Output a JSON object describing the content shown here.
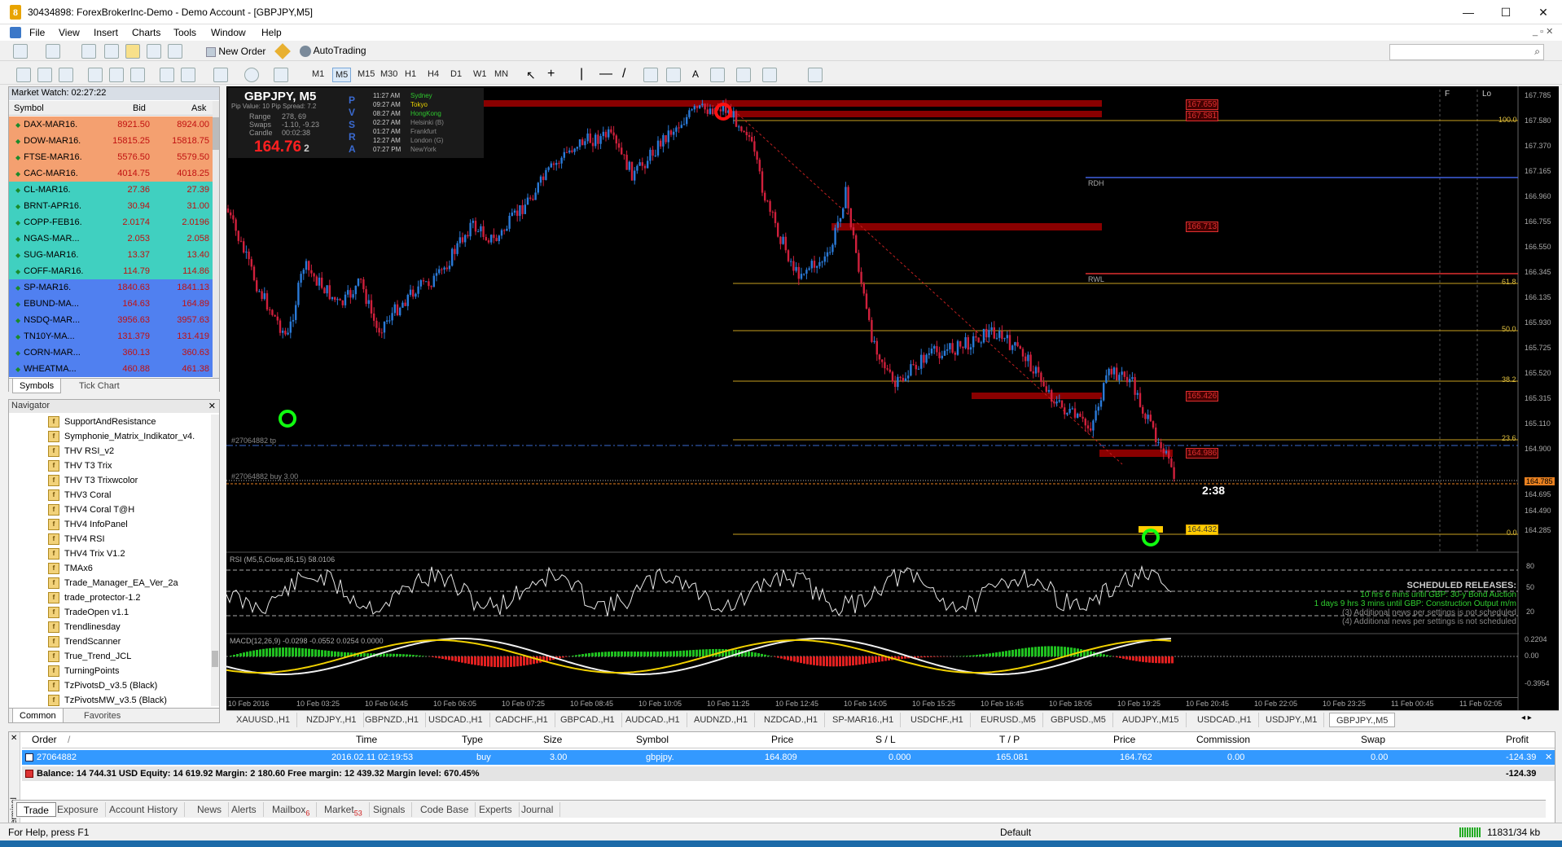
{
  "window": {
    "title": "30434898: ForexBrokerInc-Demo - Demo Account - [GBPJPY,M5]",
    "minimize": "—",
    "maximize": "☐",
    "close": "✕"
  },
  "menu": [
    "File",
    "View",
    "Insert",
    "Charts",
    "Tools",
    "Window",
    "Help"
  ],
  "toolbar": {
    "new_order": "New Order",
    "autotrading": "AutoTrading"
  },
  "timeframes": [
    "M1",
    "M5",
    "M15",
    "M30",
    "H1",
    "H4",
    "D1",
    "W1",
    "MN"
  ],
  "market_watch": {
    "title": "Market Watch: 02:27:22",
    "columns": [
      "Symbol",
      "Bid",
      "Ask"
    ],
    "rows": [
      {
        "symbol": "DAX-MAR16.",
        "bid": "8921.50",
        "ask": "8924.00",
        "bg": "#f4a070"
      },
      {
        "symbol": "DOW-MAR16.",
        "bid": "15815.25",
        "ask": "15818.75",
        "bg": "#f4a070"
      },
      {
        "symbol": "FTSE-MAR16.",
        "bid": "5576.50",
        "ask": "5579.50",
        "bg": "#f4a070"
      },
      {
        "symbol": "CAC-MAR16.",
        "bid": "4014.75",
        "ask": "4018.25",
        "bg": "#f4a070"
      },
      {
        "symbol": "CL-MAR16.",
        "bid": "27.36",
        "ask": "27.39",
        "bg": "#40d0c0"
      },
      {
        "symbol": "BRNT-APR16.",
        "bid": "30.94",
        "ask": "31.00",
        "bg": "#40d0c0"
      },
      {
        "symbol": "COPP-FEB16.",
        "bid": "2.0174",
        "ask": "2.0196",
        "bg": "#40d0c0"
      },
      {
        "symbol": "NGAS-MAR...",
        "bid": "2.053",
        "ask": "2.058",
        "bg": "#40d0c0"
      },
      {
        "symbol": "SUG-MAR16.",
        "bid": "13.37",
        "ask": "13.40",
        "bg": "#40d0c0"
      },
      {
        "symbol": "COFF-MAR16.",
        "bid": "114.79",
        "ask": "114.86",
        "bg": "#40d0c0"
      },
      {
        "symbol": "SP-MAR16.",
        "bid": "1840.63",
        "ask": "1841.13",
        "bg": "#5080f0"
      },
      {
        "symbol": "EBUND-MA...",
        "bid": "164.63",
        "ask": "164.89",
        "bg": "#5080f0"
      },
      {
        "symbol": "NSDQ-MAR...",
        "bid": "3956.63",
        "ask": "3957.63",
        "bg": "#5080f0"
      },
      {
        "symbol": "TN10Y-MA...",
        "bid": "131.379",
        "ask": "131.419",
        "bg": "#5080f0"
      },
      {
        "symbol": "CORN-MAR...",
        "bid": "360.13",
        "ask": "360.63",
        "bg": "#5080f0"
      },
      {
        "symbol": "WHEATMA...",
        "bid": "460.88",
        "ask": "461.38",
        "bg": "#5080f0"
      }
    ],
    "tabs": [
      "Symbols",
      "Tick Chart"
    ]
  },
  "navigator": {
    "title": "Navigator",
    "items": [
      "SupportAndResistance",
      "Symphonie_Matrix_Indikator_v4.",
      "THV RSI_v2",
      "THV T3 Trix",
      "THV T3 Trixwcolor",
      "THV3 Coral",
      "THV4 Coral  T@H",
      "THV4 InfoPanel",
      "THV4 RSI",
      "THV4 Trix V1.2",
      "TMAx6",
      "Trade_Manager_EA_Ver_2a",
      "trade_protector-1.2",
      "TradeOpen v1.1",
      "Trendlinesday",
      "TrendScanner",
      "True_Trend_JCL",
      "TurningPoints",
      "TzPivotsD_v3.5 (Black)",
      "TzPivotsMW_v3.5 (Black)"
    ],
    "tabs": [
      "Common",
      "Favorites"
    ]
  },
  "chart": {
    "symbol": "GBPJPY, M5",
    "pip_value": "Pip Value: 10  Pip Spread: 7.2",
    "info_labels": [
      "Range",
      "Swaps",
      "Candle"
    ],
    "info_values": [
      "278, 69",
      "-1.10, -9.23",
      "00:02:38"
    ],
    "price": "164.76",
    "price_small": "2",
    "pvsra": [
      "P",
      "V",
      "S",
      "R",
      "A"
    ],
    "sessions": [
      {
        "time": "11:27 AM",
        "city": "Sydney",
        "color": "#2ec82e"
      },
      {
        "time": "09:27 AM",
        "city": "Tokyo",
        "color": "#e8d000"
      },
      {
        "time": "08:27 AM",
        "city": "HongKong",
        "color": "#2ec82e"
      },
      {
        "time": "02:27 AM",
        "city": "Helsinki  (B)",
        "color": "#888888"
      },
      {
        "time": "01:27 AM",
        "city": "Frankfurt",
        "color": "#888888"
      },
      {
        "time": "12:27 AM",
        "city": "London  (G)",
        "color": "#888888"
      },
      {
        "time": "07:27 PM",
        "city": "NewYork",
        "color": "#888888"
      }
    ],
    "price_scale": [
      "167.785",
      "167.580",
      "167.370",
      "167.165",
      "166.960",
      "166.755",
      "166.550",
      "166.345",
      "166.135",
      "165.930",
      "165.725",
      "165.520",
      "165.315",
      "165.110",
      "164.900",
      "164.785",
      "164.695",
      "164.490",
      "164.285"
    ],
    "zone_labels": [
      "167.659",
      "167.581",
      "166.713",
      "165.426",
      "164.986",
      "164.432"
    ],
    "fib_levels": [
      "100.0",
      "61.8",
      "50.0",
      "38.2",
      "23.6",
      "0.0"
    ],
    "rdh": "RDH",
    "rwl": "RWL",
    "tp_label": "#27064882 tp",
    "buy_label": "#27064882 buy 3.00",
    "countdown": "2:38",
    "lo": "Lo",
    "f": "F",
    "rsi_label": "RSI (M5,5,Close,85,15) 58.0106",
    "rsi_scale": [
      "80",
      "50",
      "20"
    ],
    "macd_label": "MACD(12,26,9) -0.0298 -0.0552 0.0254 0.0000",
    "macd_scale": [
      "0.2204",
      "0.00",
      "-0.3954"
    ],
    "scheduled_title": "SCHEDULED RELEASES:",
    "scheduled": [
      "10 hrs 6 mins until GBP: 30-y Bond Auction",
      "1 days 9 hrs 3 mins until GBP: Construction Output m/m",
      "(3)  Additional news per settings is not scheduled",
      "(4)  Additional news per settings is not scheduled"
    ],
    "time_axis": [
      "10 Feb 2016",
      "10 Feb 03:25",
      "10 Feb 04:45",
      "10 Feb 06:05",
      "10 Feb 07:25",
      "10 Feb 08:45",
      "10 Feb 10:05",
      "10 Feb 11:25",
      "10 Feb 12:45",
      "10 Feb 14:05",
      "10 Feb 15:25",
      "10 Feb 16:45",
      "10 Feb 18:05",
      "10 Feb 19:25",
      "10 Feb 20:45",
      "10 Feb 22:05",
      "10 Feb 23:25",
      "11 Feb 00:45",
      "11 Feb 02:05"
    ]
  },
  "symbol_tabs": [
    "XAUUSD.,H1",
    "NZDJPY.,H1",
    "GBPNZD.,H1",
    "USDCAD.,H1",
    "CADCHF.,H1",
    "GBPCAD.,H1",
    "AUDCAD.,H1",
    "AUDNZD.,H1",
    "NZDCAD.,H1",
    "SP-MAR16.,H1",
    "USDCHF.,H1",
    "EURUSD.,M5",
    "GBPUSD.,M5",
    "AUDJPY.,M15",
    "USDCAD.,H1",
    "USDJPY.,M1",
    "GBPJPY.,M5"
  ],
  "terminal": {
    "columns": [
      "Order",
      "/",
      "Time",
      "Type",
      "Size",
      "Symbol",
      "Price",
      "S / L",
      "T / P",
      "Price",
      "Commission",
      "Swap",
      "Profit"
    ],
    "order": {
      "order": "27064882",
      "time": "2016.02.11 02:19:53",
      "type": "buy",
      "size": "3.00",
      "symbol": "gbpjpy.",
      "price": "164.809",
      "sl": "0.000",
      "tp": "165.081",
      "cur_price": "164.762",
      "commission": "0.00",
      "swap": "0.00",
      "profit": "-124.39"
    },
    "balance": "Balance: 14 744.31 USD  Equity: 14 619.92  Margin: 2 180.60  Free margin: 12 439.32  Margin level: 670.45%",
    "balance_profit": "-124.39",
    "tabs": [
      "Trade",
      "Exposure",
      "Account History",
      "News",
      "Alerts",
      "Mailbox",
      "Market",
      "Signals",
      "Code Base",
      "Experts",
      "Journal"
    ],
    "mailbox_badge": "6",
    "market_badge": "53",
    "side_label": "Terminal"
  },
  "status": {
    "help": "For Help, press F1",
    "profile": "Default",
    "traffic": "11831/34 kb"
  }
}
